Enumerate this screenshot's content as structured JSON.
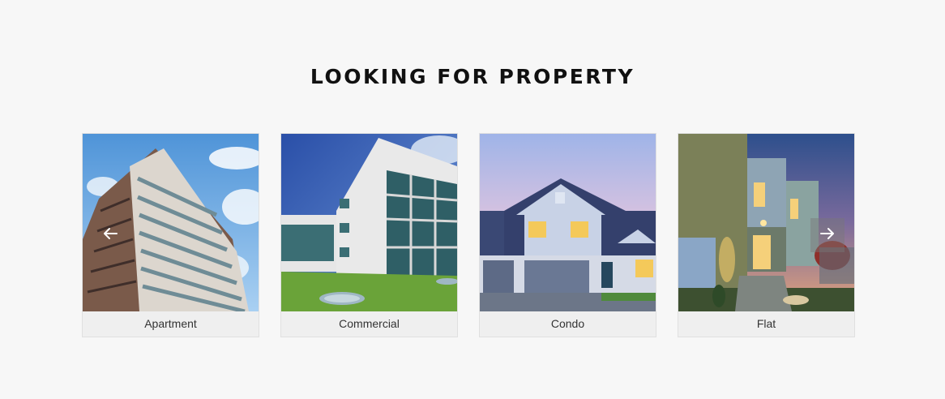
{
  "section": {
    "title": "LOOKING FOR PROPERTY"
  },
  "carousel": {
    "prev_icon": "arrow-left-icon",
    "next_icon": "arrow-right-icon",
    "cards": [
      {
        "label": "Apartment"
      },
      {
        "label": "Commercial"
      },
      {
        "label": "Condo"
      },
      {
        "label": "Flat"
      }
    ]
  }
}
